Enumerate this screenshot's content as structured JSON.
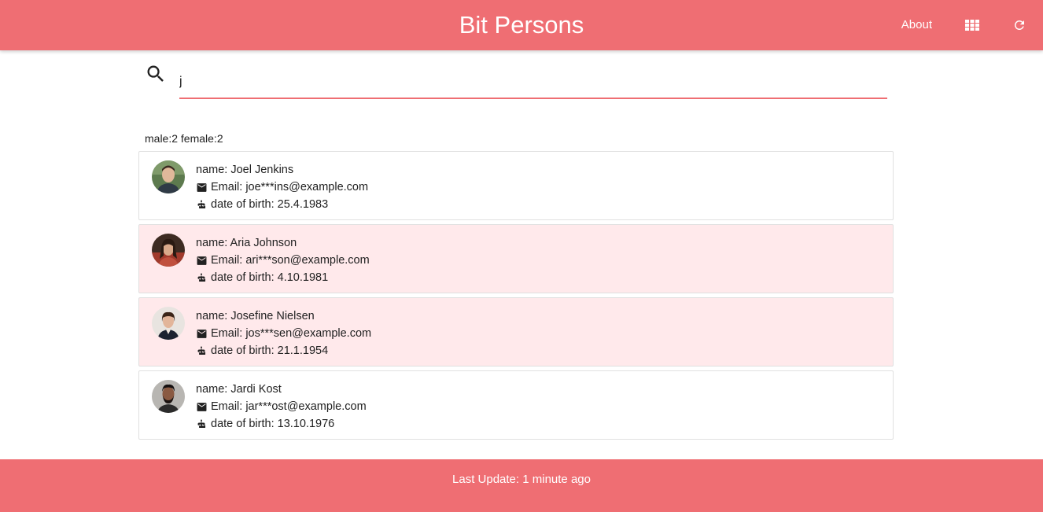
{
  "header": {
    "title": "Bit Persons",
    "about_label": "About",
    "grid_icon": "grid-view-icon",
    "refresh_icon": "refresh-icon"
  },
  "search": {
    "value": "j",
    "icon": "search-icon"
  },
  "stats": {
    "text": "male:2 female:2"
  },
  "persons": [
    {
      "name": "name: Joel Jenkins",
      "email": "Email: joe***ins@example.com",
      "dob": "date of birth: 25.4.1983",
      "gender": "male"
    },
    {
      "name": "name: Aria Johnson",
      "email": "Email: ari***son@example.com",
      "dob": "date of birth: 4.10.1981",
      "gender": "female"
    },
    {
      "name": "name: Josefine Nielsen",
      "email": "Email: jos***sen@example.com",
      "dob": "date of birth: 21.1.1954",
      "gender": "female"
    },
    {
      "name": "name: Jardi Kost",
      "email": "Email: jar***ost@example.com",
      "dob": "date of birth: 13.10.1976",
      "gender": "male"
    }
  ],
  "footer": {
    "text": "Last Update: 1 minute ago"
  },
  "colors": {
    "primary": "#ef6e73",
    "female_card": "#ffe9eb"
  }
}
